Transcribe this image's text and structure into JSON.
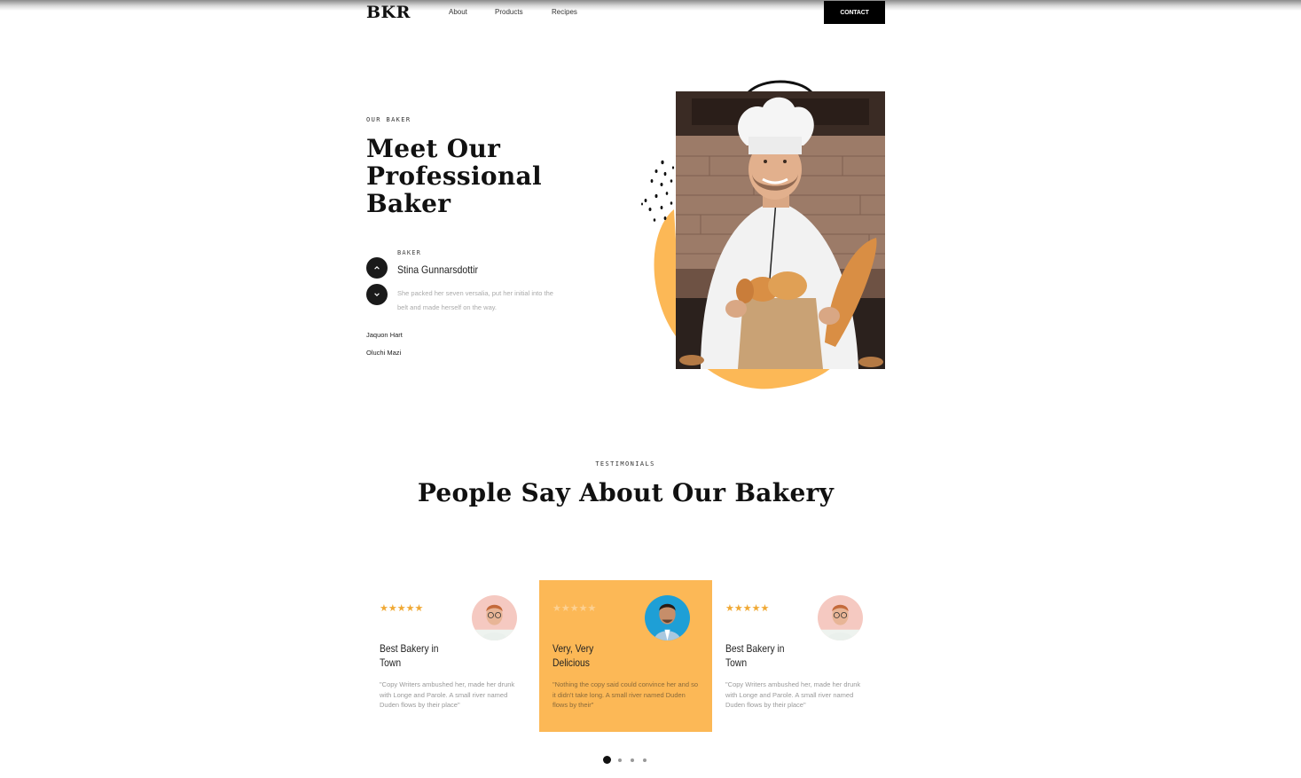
{
  "nav": {
    "logo": "BKR",
    "links": [
      "About",
      "Products",
      "Recipes"
    ],
    "contact_label": "CONTACT"
  },
  "baker_section": {
    "eyebrow": "OUR BAKER",
    "title": "Meet Our Professional Baker",
    "role": "BAKER",
    "name": "Stina Gunnarsdottir",
    "description": "She packed her seven versalia, put her initial into the belt and made herself on the way.",
    "other_bakers": [
      "Jaquon Hart",
      "Oluchi Mazi"
    ]
  },
  "testimonials": {
    "eyebrow": "TESTIMONIALS",
    "title": "People Say About Our Bakery",
    "cards": [
      {
        "stars": "★★★★★",
        "title": "Best Bakery in Town",
        "quote": "\"Copy Writers ambushed her, made her drunk with Longe and Parole. A small river named Duden flows by their place\""
      },
      {
        "stars": "★★★★★",
        "title": "Very, Very Delicious",
        "quote": "\"Nothing the copy said could convince her and so it didn't take long. A small river named Duden flows by their\""
      },
      {
        "stars": "★★★★★",
        "title": "Best Bakery in Town",
        "quote": "\"Copy Writers ambushed her, made her drunk with Longe and Parole. A small river named Duden flows by their place\""
      }
    ],
    "carousel_pages": 4,
    "active_page": 1
  },
  "colors": {
    "accent": "#fcb856",
    "star": "#f0a935",
    "dark": "#111111"
  }
}
